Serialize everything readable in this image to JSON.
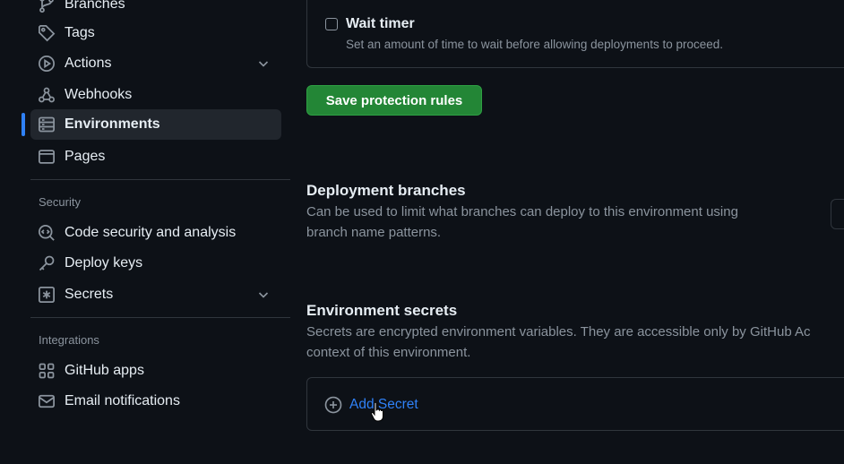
{
  "sidebar": {
    "items": [
      {
        "label": "Branches",
        "icon": "branch-icon"
      },
      {
        "label": "Tags",
        "icon": "tag-icon"
      },
      {
        "label": "Actions",
        "icon": "play-icon",
        "expandable": true
      },
      {
        "label": "Webhooks",
        "icon": "webhook-icon"
      },
      {
        "label": "Environments",
        "icon": "server-icon",
        "active": true
      },
      {
        "label": "Pages",
        "icon": "browser-icon"
      }
    ],
    "security_heading": "Security",
    "security_items": [
      {
        "label": "Code security and analysis",
        "icon": "codescan-icon"
      },
      {
        "label": "Deploy keys",
        "icon": "key-icon"
      },
      {
        "label": "Secrets",
        "icon": "asterisk-icon",
        "expandable": true
      }
    ],
    "integrations_heading": "Integrations",
    "integrations_items": [
      {
        "label": "GitHub apps",
        "icon": "apps-icon"
      },
      {
        "label": "Email notifications",
        "icon": "mail-icon"
      }
    ]
  },
  "main": {
    "wait_timer": {
      "title": "Wait timer",
      "description": "Set an amount of time to wait before allowing deployments to proceed.",
      "checked": false
    },
    "save_button": "Save protection rules",
    "deployment_branches": {
      "title": "Deployment branches",
      "description_line1": "Can be used to limit what branches can deploy to this environment using",
      "description_line2": "branch name patterns."
    },
    "environment_secrets": {
      "title": "Environment secrets",
      "description_line1": "Secrets are encrypted environment variables. They are accessible only by GitHub Ac",
      "description_line2": "context of this environment.",
      "add_label": "Add Secret"
    }
  },
  "colors": {
    "background": "#0d1117",
    "accent": "#2f81f7",
    "save_green": "#238636",
    "muted_text": "#8b949e",
    "border": "#30363d"
  }
}
